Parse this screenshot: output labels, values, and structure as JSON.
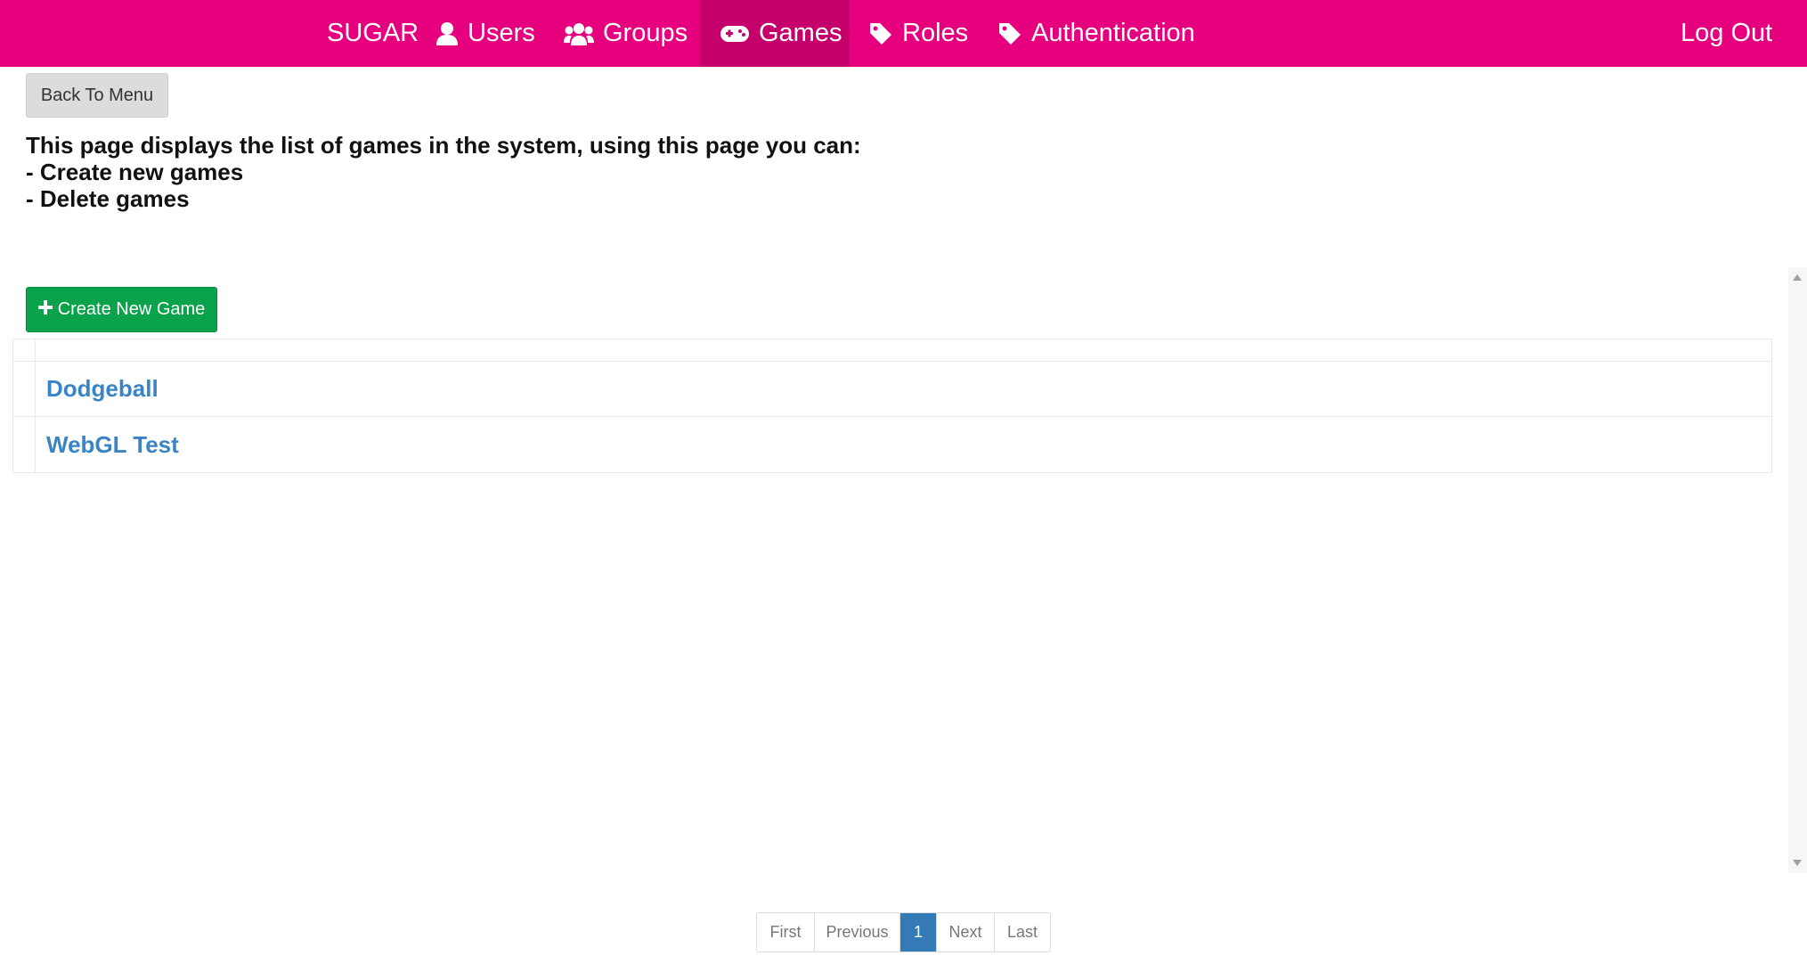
{
  "nav": {
    "brand": "SUGAR",
    "items": [
      {
        "label": "Users",
        "icon": "user-icon"
      },
      {
        "label": "Groups",
        "icon": "users-icon"
      },
      {
        "label": "Games",
        "icon": "gamepad-icon",
        "active": true
      },
      {
        "label": "Roles",
        "icon": "tag-icon"
      },
      {
        "label": "Authentication",
        "icon": "tag-icon"
      }
    ],
    "logout": "Log Out"
  },
  "toolbar": {
    "back_label": "Back To Menu",
    "create_label": "Create New Game"
  },
  "intro": {
    "lines": [
      "This page displays the list of games in the system, using this page you can:",
      "- Create new games",
      "- Delete games"
    ]
  },
  "games": {
    "rows": [
      {
        "name": "Dodgeball"
      },
      {
        "name": "WebGL Test"
      }
    ]
  },
  "pagination": {
    "first": "First",
    "previous": "Previous",
    "current": "1",
    "next": "Next",
    "last": "Last"
  },
  "colors": {
    "navbar": "#e6007e",
    "navbar_active": "#c5006c",
    "create_button": "#0aa24a",
    "link": "#3b84c4",
    "page_active": "#337ab7"
  }
}
